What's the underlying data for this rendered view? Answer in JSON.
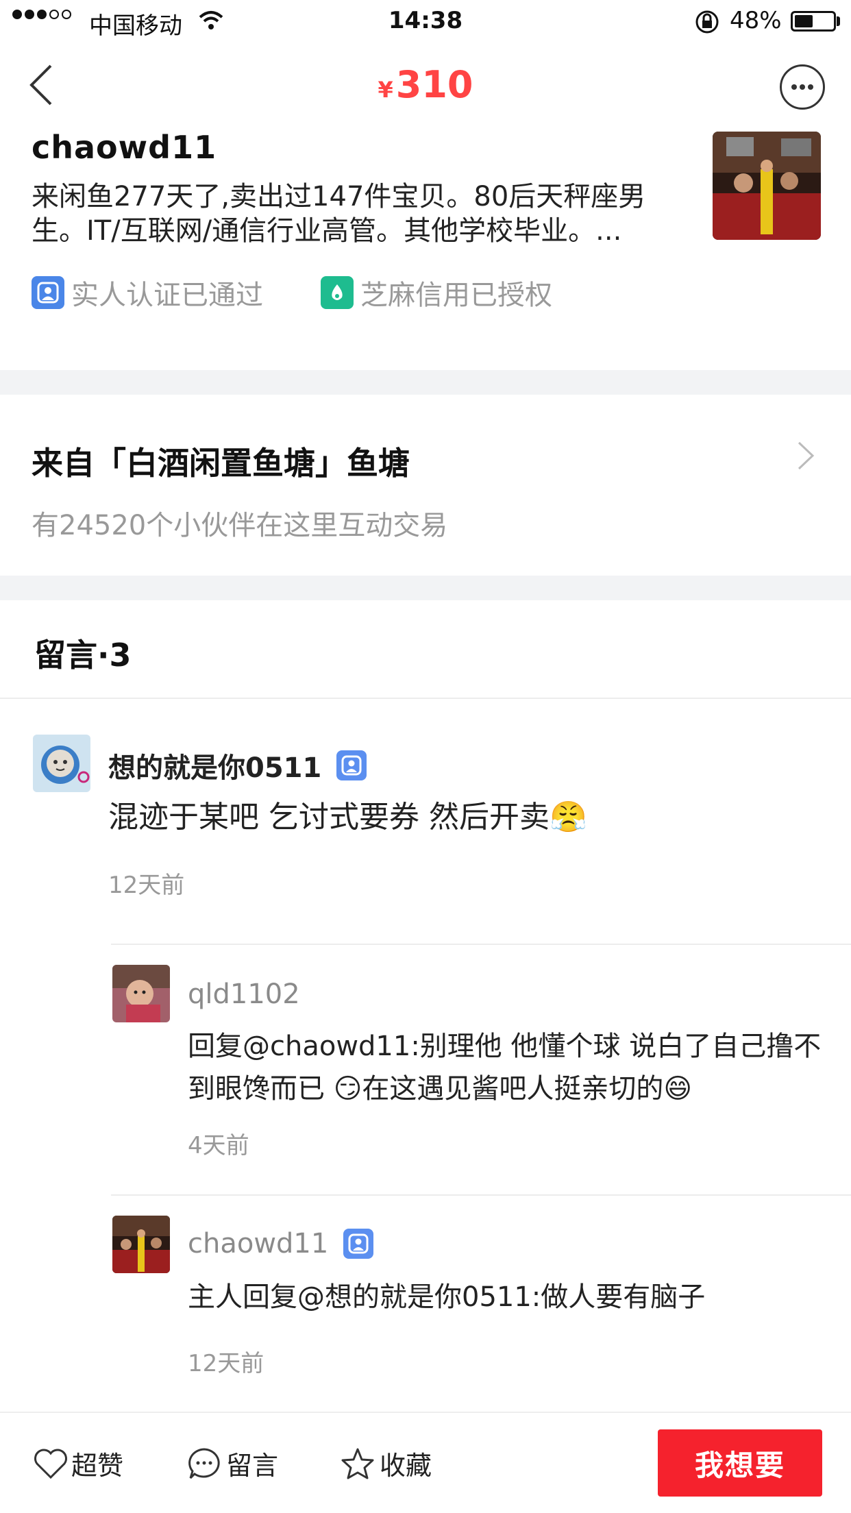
{
  "status_bar": {
    "carrier": "中国移动",
    "time": "14:38",
    "battery_percent": "48%",
    "battery_level": 0.48
  },
  "header": {
    "currency": "¥",
    "price": "310"
  },
  "seller": {
    "name": "chaowd11",
    "description": "来闲鱼277天了,卖出过147件宝贝。80后天秤座男生。IT/互联网/通信行业高管。其他学校毕业。...",
    "badges": [
      {
        "label": "实人认证已通过",
        "icon": "realname-icon",
        "color": "#4a86e8"
      },
      {
        "label": "芝麻信用已授权",
        "icon": "sesame-icon",
        "color": "#1ebc8f"
      }
    ]
  },
  "pond": {
    "title": "来自「白酒闲置鱼塘」鱼塘",
    "subtitle": "有24520个小伙伴在这里互动交易"
  },
  "comments": {
    "title": "留言·3",
    "items": [
      {
        "name": "想的就是你0511",
        "text": "混迹于某吧  乞讨式要券 然后开卖😤",
        "time": "12天前"
      },
      {
        "name": "qld1102",
        "text": "回复@chaowd11:别理他 他懂个球 说白了自己撸不到眼馋而已 😏在这遇见酱吧人挺亲切的😄",
        "time": "4天前"
      },
      {
        "name": "chaowd11",
        "text": "主人回复@想的就是你0511:做人要有脑子",
        "time": "12天前"
      }
    ]
  },
  "toolbar": {
    "like_label": "超赞",
    "comment_label": "留言",
    "favorite_label": "收藏",
    "want_label": "我想要"
  },
  "colors": {
    "price": "#ff4444",
    "want_button": "#f5222d",
    "divider": "#f2f3f5"
  }
}
